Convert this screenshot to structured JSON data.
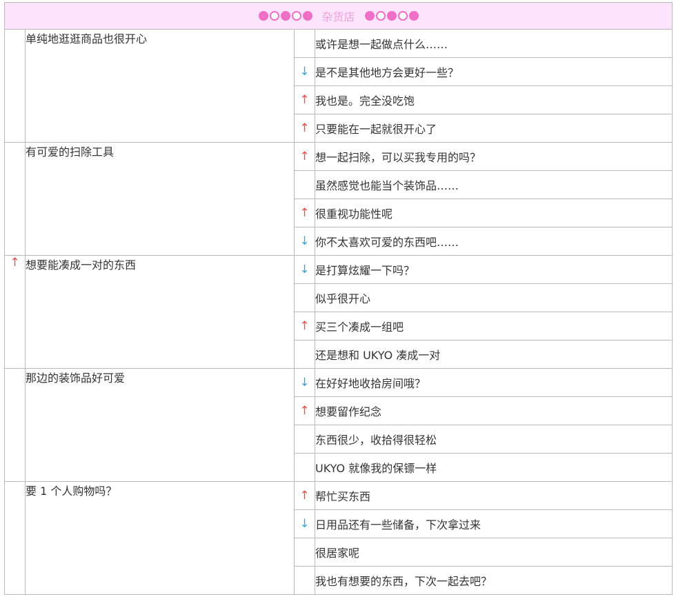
{
  "header": {
    "title": "杂货店",
    "dots_left": [
      "filled",
      "open",
      "filled",
      "open",
      "filled"
    ],
    "dots_right": [
      "filled",
      "open",
      "filled",
      "open",
      "filled"
    ]
  },
  "colors": {
    "up": "#e8504a",
    "down": "#3aa6d8",
    "header_bg": "#fce4fc",
    "header_text": "#f0a0d8",
    "dot": "#f06fc6"
  },
  "groups": [
    {
      "arrow": "",
      "choice": "单纯地逛逛商品也很开心",
      "responses": [
        {
          "arrow": "",
          "text": "或许是想一起做点什么……"
        },
        {
          "arrow": "↓",
          "text": "是不是其他地方会更好一些？"
        },
        {
          "arrow": "↑",
          "text": "我也是。完全没吃饱"
        },
        {
          "arrow": "↑",
          "text": "只要能在一起就很开心了"
        }
      ]
    },
    {
      "arrow": "",
      "choice": "有可爱的扫除工具",
      "responses": [
        {
          "arrow": "↑",
          "text": "想一起扫除，可以买我专用的吗？"
        },
        {
          "arrow": "",
          "text": "虽然感觉也能当个装饰品……"
        },
        {
          "arrow": "↑",
          "text": "很重视功能性呢"
        },
        {
          "arrow": "↓",
          "text": "你不太喜欢可爱的东西吧……"
        }
      ]
    },
    {
      "arrow": "↑",
      "choice": "想要能凑成一对的东西",
      "responses": [
        {
          "arrow": "↓",
          "text": "是打算炫耀一下吗？"
        },
        {
          "arrow": "",
          "text": "似乎很开心"
        },
        {
          "arrow": "↑",
          "text": "买三个凑成一组吧"
        },
        {
          "arrow": "",
          "text": "还是想和 UKYO 凑成一对"
        }
      ]
    },
    {
      "arrow": "",
      "choice": "那边的装饰品好可爱",
      "responses": [
        {
          "arrow": "↓",
          "text": "在好好地收拾房间哦？"
        },
        {
          "arrow": "↑",
          "text": "想要留作纪念"
        },
        {
          "arrow": "",
          "text": "东西很少，收拾得很轻松"
        },
        {
          "arrow": "",
          "text": "UKYO 就像我的保镖一样"
        }
      ]
    },
    {
      "arrow": "",
      "choice": "要 1 个人购物吗？",
      "responses": [
        {
          "arrow": "↑",
          "text": "帮忙买东西"
        },
        {
          "arrow": "↓",
          "text": "日用品还有一些储备，下次拿过来"
        },
        {
          "arrow": "",
          "text": "很居家呢"
        },
        {
          "arrow": "",
          "text": "我也有想要的东西，下次一起去吧？"
        }
      ]
    }
  ]
}
